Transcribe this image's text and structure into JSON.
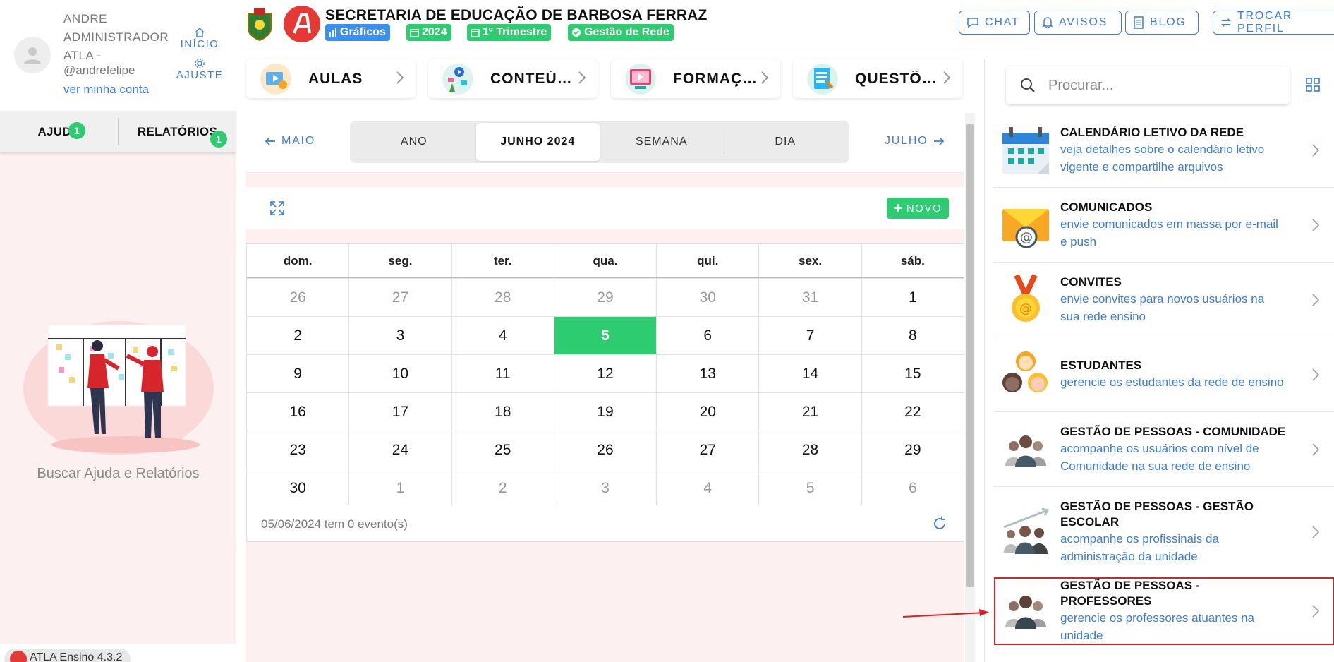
{
  "user": {
    "name": "ANDRE ADMINISTRADOR ATLA -",
    "handle": "@andrefelipe",
    "account_link": "ver minha conta"
  },
  "sidebar": {
    "inicio_label": "INÍCIO",
    "ajuste_label": "AJUSTE",
    "tabs": [
      {
        "label": "AJUDA",
        "badge": "1"
      },
      {
        "label": "RELATÓRIOS",
        "badge": "1"
      }
    ],
    "help_caption": "Buscar Ajuda e Relatórios",
    "version": "ATLA Ensino 4.3.2"
  },
  "header": {
    "org_title": "SECRETARIA DE EDUCAÇÃO DE BARBOSA FERRAZ",
    "chips": {
      "graficos": "Gráficos",
      "year": "2024",
      "trimestre": "1º Trimestre",
      "gestao": "Gestão de Rede"
    },
    "buttons": {
      "chat": "CHAT",
      "avisos": "AVISOS",
      "blog": "BLOG",
      "trocar": "TROCAR PERFIL"
    }
  },
  "categories": [
    {
      "label": "AULAS",
      "icon": "aulas-icon"
    },
    {
      "label": "CONTEÚDOS",
      "icon": "conteudos-icon"
    },
    {
      "label": "FORMAÇÕES",
      "icon": "formacoes-icon"
    },
    {
      "label": "QUESTÕES",
      "icon": "questoes-icon"
    }
  ],
  "calendar": {
    "prev_month": "MAIO",
    "next_month": "JULHO",
    "views": [
      "ANO",
      "JUNHO 2024",
      "SEMANA",
      "DIA"
    ],
    "active_view": "JUNHO 2024",
    "new_button": "NOVO",
    "weekdays": [
      "dom.",
      "seg.",
      "ter.",
      "qua.",
      "qui.",
      "sex.",
      "sáb."
    ],
    "weeks": [
      [
        "26",
        "27",
        "28",
        "29",
        "30",
        "31",
        "1"
      ],
      [
        "2",
        "3",
        "4",
        "5",
        "6",
        "7",
        "8"
      ],
      [
        "9",
        "10",
        "11",
        "12",
        "13",
        "14",
        "15"
      ],
      [
        "16",
        "17",
        "18",
        "19",
        "20",
        "21",
        "22"
      ],
      [
        "23",
        "24",
        "25",
        "26",
        "27",
        "28",
        "29"
      ],
      [
        "30",
        "1",
        "2",
        "3",
        "4",
        "5",
        "6"
      ]
    ],
    "today": "5",
    "events_text": "05/06/2024 tem 0 evento(s)"
  },
  "panel": {
    "search_placeholder": "Procurar...",
    "items": [
      {
        "title": "CALENDÁRIO LETIVO DA REDE",
        "desc": "veja detalhes sobre o calendário letivo vigente e compartilhe arquivos",
        "icon": "calendar-icon"
      },
      {
        "title": "COMUNICADOS",
        "desc": "envie comunicados em massa por e-mail e push",
        "icon": "envelope-icon"
      },
      {
        "title": "CONVITES",
        "desc": "envie convites para novos usuários na sua rede ensino",
        "icon": "medal-icon"
      },
      {
        "title": "ESTUDANTES",
        "desc": "gerencie os estudantes da rede de ensino",
        "icon": "students-icon"
      },
      {
        "title": "GESTÃO DE PESSOAS - COMUNIDADE",
        "desc": "acompanhe os usuários com nível de Comunidade na sua rede de ensino",
        "icon": "community-icon"
      },
      {
        "title": "GESTÃO DE PESSOAS - GESTÃO ESCOLAR",
        "desc": "acompanhe os profissinais da administração da unidade",
        "icon": "school-management-icon"
      },
      {
        "title": "GESTÃO DE PESSOAS - PROFESSORES",
        "desc": "gerencie os professores atuantes na unidade",
        "icon": "teachers-icon"
      }
    ]
  },
  "colors": {
    "accent_blue": "#3b7bd9",
    "success_green": "#2ecc71",
    "brand_red": "#e53935",
    "sidebar_bg": "#fdf0f0"
  }
}
